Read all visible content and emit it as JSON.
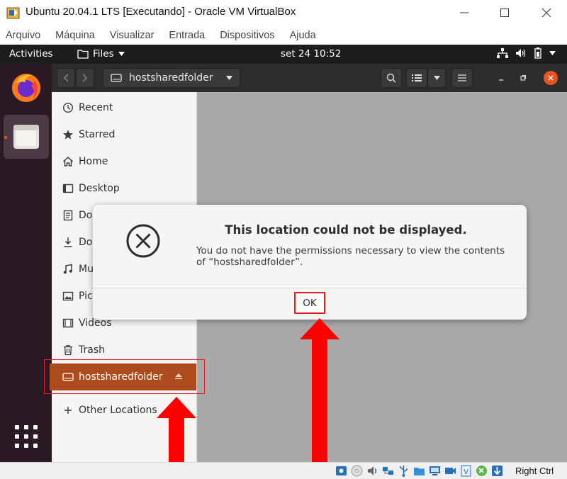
{
  "window": {
    "title": "Ubuntu 20.04.1 LTS [Executando] - Oracle VM VirtualBox",
    "menu": [
      "Arquivo",
      "Máquina",
      "Visualizar",
      "Entrada",
      "Dispositivos",
      "Ajuda"
    ]
  },
  "topbar": {
    "activities": "Activities",
    "app_menu": "Files",
    "clock": "set 24  10:52"
  },
  "dock": {
    "apps": [
      "firefox-icon",
      "files-icon"
    ],
    "accent": "#e95420"
  },
  "nautilus": {
    "path_label": "hostsharedfolder",
    "sidebar": [
      {
        "label": "Recent",
        "icon": "clock-icon"
      },
      {
        "label": "Starred",
        "icon": "star-icon"
      },
      {
        "label": "Home",
        "icon": "home-icon"
      },
      {
        "label": "Desktop",
        "icon": "desktop-icon"
      },
      {
        "label": "Documents",
        "icon": "document-icon"
      },
      {
        "label": "Downloads",
        "icon": "download-icon"
      },
      {
        "label": "Music",
        "icon": "music-icon"
      },
      {
        "label": "Pictures",
        "icon": "picture-icon"
      },
      {
        "label": "Videos",
        "icon": "video-icon"
      },
      {
        "label": "Trash",
        "icon": "trash-icon"
      }
    ],
    "selected_item": "hostsharedfolder",
    "other_locations": "Other Locations",
    "selected_color": "#ae4b1d"
  },
  "dialog": {
    "title": "This location could not be displayed.",
    "message": "You do not have the permissions necessary to view the contents of “hostsharedfolder”.",
    "ok_label": "OK"
  },
  "statusbar": {
    "host_key": "Right Ctrl"
  },
  "annotation_color": "#ff0000"
}
